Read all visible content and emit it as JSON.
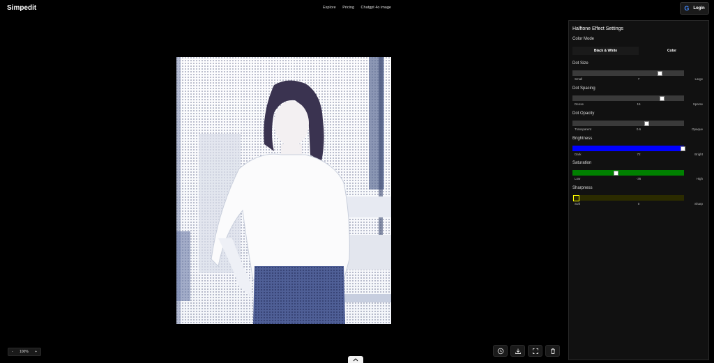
{
  "header": {
    "brand": "Simpedit",
    "nav": [
      "Explore",
      "Pricing",
      "Chatgpt 4o image"
    ],
    "login_label": "Login"
  },
  "panel": {
    "title": "Halftone Effect Settings",
    "color_mode": {
      "label": "Color Mode",
      "options": [
        "Black & White",
        "Color"
      ],
      "selected": "Black & White"
    },
    "sliders": [
      {
        "label": "Dot Size",
        "min_label": "Small",
        "value": "7",
        "max_label": "Large",
        "fraction": 0.78,
        "color": "#3a3a3a"
      },
      {
        "label": "Dot Spacing",
        "min_label": "Dense",
        "value": "15",
        "max_label": "Sparse",
        "fraction": 0.8,
        "color": "#3a3a3a"
      },
      {
        "label": "Dot Opacity",
        "min_label": "Transparent",
        "value": "0.6",
        "max_label": "Opaque",
        "fraction": 0.66,
        "color": "#3a3a3a"
      },
      {
        "label": "Brightness",
        "min_label": "Dark",
        "value": "72",
        "max_label": "Bright",
        "fraction": 0.99,
        "color": "#0000ff"
      },
      {
        "label": "Saturation",
        "min_label": "Low",
        "value": "-36",
        "max_label": "High",
        "fraction": 0.39,
        "color": "#008000"
      },
      {
        "label": "Sharpness",
        "min_label": "Soft",
        "value": "0",
        "max_label": "Sharp",
        "fraction": 0.0,
        "color": "#2b2b00",
        "thumb_color": "#ffff00"
      }
    ]
  },
  "zoom": {
    "minus": "-",
    "value": "100%",
    "plus": "+"
  },
  "tools": [
    "history-icon",
    "download-icon",
    "fullscreen-icon",
    "trash-icon"
  ]
}
